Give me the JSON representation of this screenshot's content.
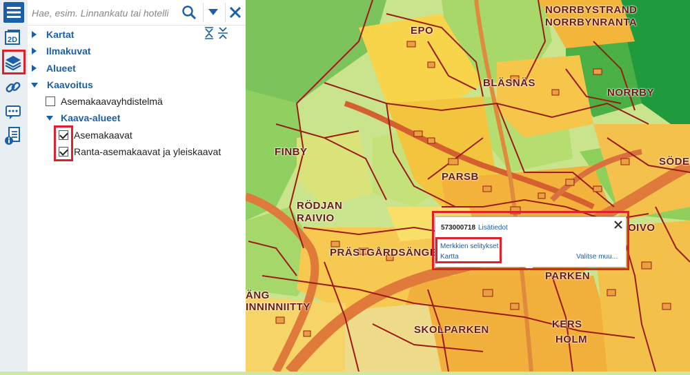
{
  "search": {
    "placeholder": "Hae, esim. Linnankatu tai hotelli"
  },
  "tree": {
    "kartat": "Kartat",
    "ilmakuvat": "Ilmakuvat",
    "alueet": "Alueet",
    "kaavoitus": "Kaavoitus",
    "asemakaavayhdistelma": "Asemakaavayhdistelmä",
    "kaava_alueet": "Kaava-alueet",
    "asemakaavat": "Asemakaavat",
    "ranta": "Ranta-asemakaavat ja yleiskaavat"
  },
  "toolbar": {
    "view2d_label": "2D"
  },
  "popup": {
    "id": "573000718",
    "more_info": "Lisätiedot",
    "legend_link": "Merkkien selitykset",
    "map_link": "Kartta",
    "select_other": "Valitse muu..."
  },
  "map_labels": {
    "norrbystrand": "NORRBYSTRAND",
    "norrbynranta": "NORRBYNRANTA",
    "epo": "EPO",
    "blasnas": "BLÄSNÄS",
    "norrby": "NORRBY",
    "finby": "FINBY",
    "parsb": "PARSB",
    "roedjan": "RÖDJAN",
    "raivio": "RAIVIO",
    "soder": "SÖDER",
    "oivo": "OIVO",
    "prastgards": "PRÄSTGÅRDSÄNGEN",
    "parken": "PARKEN",
    "ang": "ÄNG",
    "inninniitty": "INNINNIITTY",
    "skolparken": "SKOLPARKEN",
    "kers": "KERS",
    "holm": "HOLM"
  },
  "colors": {
    "accent": "#1b5fa8",
    "highlight": "#e0202a",
    "plan_boundary": "#9b1b12",
    "road": "#e07a3a"
  },
  "icons": {
    "menu": "hamburger-menu-icon",
    "search": "search-icon",
    "dropdown": "chevron-down-icon",
    "close": "close-icon",
    "expand_collapse": "expand-collapse-icon",
    "view2d": "view-2d-icon",
    "layers": "layers-icon",
    "link": "link-icon",
    "chat": "chat-icon",
    "info": "info-document-icon"
  }
}
